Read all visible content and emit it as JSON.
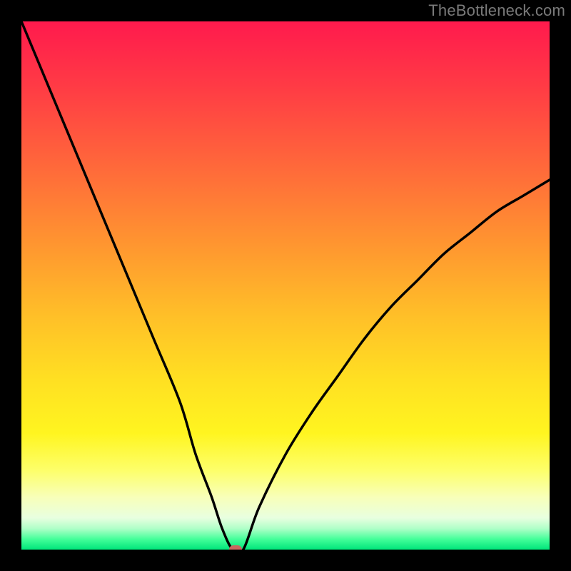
{
  "watermark": "TheBottleneck.com",
  "colors": {
    "background": "#000000",
    "curve": "#000000",
    "marker": "#c9675f",
    "gradient_stops": [
      {
        "pct": 0,
        "hex": "#ff1a4d"
      },
      {
        "pct": 12,
        "hex": "#ff3a45"
      },
      {
        "pct": 28,
        "hex": "#ff6a3a"
      },
      {
        "pct": 42,
        "hex": "#ff9530"
      },
      {
        "pct": 56,
        "hex": "#ffc028"
      },
      {
        "pct": 68,
        "hex": "#ffe022"
      },
      {
        "pct": 78,
        "hex": "#fff520"
      },
      {
        "pct": 85,
        "hex": "#fdff6a"
      },
      {
        "pct": 90,
        "hex": "#f8ffb8"
      },
      {
        "pct": 94,
        "hex": "#e8ffe0"
      },
      {
        "pct": 96,
        "hex": "#b0ffc8"
      },
      {
        "pct": 98,
        "hex": "#45ff9a"
      },
      {
        "pct": 100,
        "hex": "#00e57a"
      }
    ]
  },
  "chart_data": {
    "type": "line",
    "title": "",
    "xlabel": "",
    "ylabel": "",
    "xlim": [
      0,
      100
    ],
    "ylim": [
      0,
      100
    ],
    "dip_x": 40,
    "notes": "V-shaped bottleneck curve. x ≈ relative component position (0–100). y ≈ bottleneck severity %, 0 at minimum (optimal), 100 at top (worst). Values estimated from pixels; no axes shown in source.",
    "series": [
      {
        "name": "bottleneck-curve",
        "x": [
          0,
          5,
          10,
          15,
          20,
          25,
          30,
          33,
          36,
          38,
          40,
          42,
          45,
          50,
          55,
          60,
          65,
          70,
          75,
          80,
          85,
          90,
          95,
          100
        ],
        "y": [
          100,
          88,
          76,
          64,
          52,
          40,
          28,
          18,
          10,
          4,
          0,
          0,
          8,
          18,
          26,
          33,
          40,
          46,
          51,
          56,
          60,
          64,
          67,
          70
        ]
      }
    ],
    "flat_segment_x": [
      38,
      42
    ],
    "marker": {
      "x": 40.5,
      "y": 0
    }
  }
}
